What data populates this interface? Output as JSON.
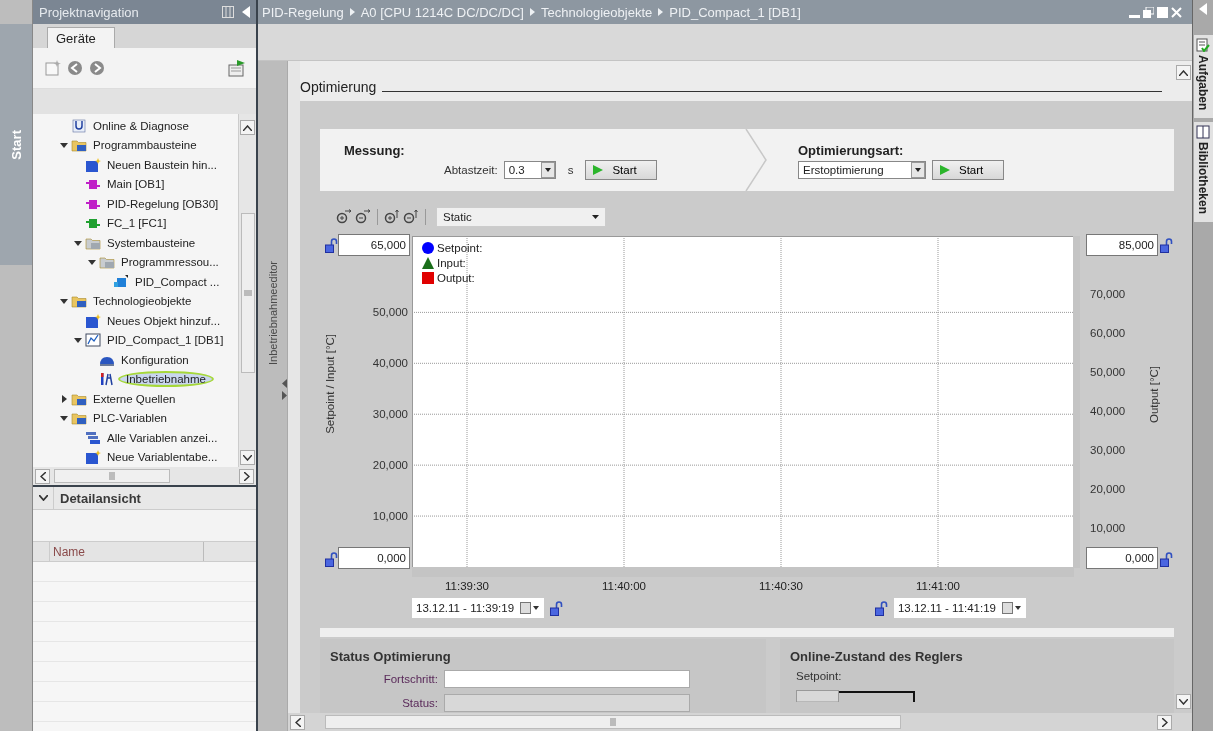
{
  "left_strip": {
    "label": "Start"
  },
  "project_nav": {
    "title": "Projektnavigation",
    "tabs": [
      {
        "label": "Geräte",
        "selected": true
      }
    ],
    "tree": [
      {
        "label": "Online & Diagnose",
        "kind": "diagnose"
      },
      {
        "label": "Programmbausteine",
        "kind": "folder",
        "expanded": true,
        "children": [
          {
            "label": "Neuen Baustein hin...",
            "kind": "add"
          },
          {
            "label": "Main [OB1]",
            "kind": "block"
          },
          {
            "label": "PID-Regelung [OB30]",
            "kind": "block"
          },
          {
            "label": "FC_1 [FC1]",
            "kind": "function"
          },
          {
            "label": "Systembausteine",
            "kind": "system",
            "expanded": true,
            "children": [
              {
                "label": "Programmressou...",
                "kind": "system",
                "expanded": true,
                "children": [
                  {
                    "label": "PID_Compact ...",
                    "kind": "instance"
                  }
                ]
              }
            ]
          }
        ]
      },
      {
        "label": "Technologieobjekte",
        "kind": "folder",
        "expanded": true,
        "children": [
          {
            "label": "Neues Objekt hinzuf...",
            "kind": "add"
          },
          {
            "label": "PID_Compact_1 [DB1]",
            "kind": "pid",
            "expanded": true,
            "children": [
              {
                "label": "Konfiguration",
                "kind": "config"
              },
              {
                "label": "Inbetriebnahme",
                "kind": "commission",
                "highlighted": true
              }
            ]
          }
        ]
      },
      {
        "label": "Externe Quellen",
        "kind": "folder",
        "expanded": false
      },
      {
        "label": "PLC-Variablen",
        "kind": "folder",
        "expanded": true,
        "children": [
          {
            "label": "Alle Variablen anzei...",
            "kind": "vars"
          },
          {
            "label": "Neue Variablentabe...",
            "kind": "add"
          }
        ]
      }
    ],
    "detail": {
      "title": "Detailansicht",
      "columns": [
        "Name"
      ]
    }
  },
  "editor_strip": {
    "label": "Inbetriebnahmeeditor"
  },
  "breadcrumb": [
    "PID-Regelung",
    "A0 [CPU 1214C DC/DC/DC]",
    "Technologieobjekte",
    "PID_Compact_1 [DB1]"
  ],
  "right_tabs": [
    {
      "label": "Aufgaben",
      "kind": "tasks"
    },
    {
      "label": "Bibliotheken",
      "kind": "library"
    }
  ],
  "section_title": "Optimierung",
  "measurement": {
    "title": "Messung:",
    "sample_label": "Abtastzeit:",
    "sample_value": "0.3",
    "unit": "s",
    "start": "Start"
  },
  "tuning": {
    "title": "Optimierungsart:",
    "mode": "Erstoptimierung",
    "start": "Start"
  },
  "chart": {
    "view_mode": "Static",
    "legend": [
      {
        "label": "Setpoint:",
        "kind": "setpoint",
        "color": "#0000ff"
      },
      {
        "label": "Input:",
        "kind": "input",
        "color": "#1a6e1a"
      },
      {
        "label": "Output:",
        "kind": "output",
        "color": "#e00000"
      }
    ],
    "left_axis": {
      "title": "Setpoint / Input [°C]",
      "max": "65,000",
      "min": "0,000",
      "ticks": [
        "50,000",
        "40,000",
        "30,000",
        "20,000",
        "10,000"
      ]
    },
    "right_axis": {
      "title": "Output [°C]",
      "max": "85,000",
      "min": "0,000",
      "ticks": [
        "70,000",
        "60,000",
        "50,000",
        "40,000",
        "30,000",
        "20,000",
        "10,000"
      ]
    },
    "time_ticks": [
      "11:39:30",
      "11:40:00",
      "11:40:30",
      "11:41:00"
    ],
    "start_time": "13.12.11 - 11:39:19",
    "end_time": "13.12.11 - 11:41:19"
  },
  "status": {
    "title": "Status Optimierung",
    "fields": [
      {
        "label": "Fortschritt:"
      },
      {
        "label": "Status:"
      }
    ]
  },
  "online": {
    "title": "Online-Zustand des Reglers",
    "setpoint_label": "Setpoint:"
  }
}
